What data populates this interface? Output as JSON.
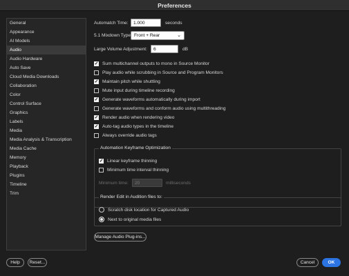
{
  "window": {
    "title": "Preferences"
  },
  "sidebar": {
    "items": [
      {
        "label": "General"
      },
      {
        "label": "Appearance"
      },
      {
        "label": "AI Models"
      },
      {
        "label": "Audio"
      },
      {
        "label": "Audio Hardware"
      },
      {
        "label": "Auto Save"
      },
      {
        "label": "Cloud Media Downloads"
      },
      {
        "label": "Collaboration"
      },
      {
        "label": "Color"
      },
      {
        "label": "Control Surface"
      },
      {
        "label": "Graphics"
      },
      {
        "label": "Labels"
      },
      {
        "label": "Media"
      },
      {
        "label": "Media Analysis & Transcription"
      },
      {
        "label": "Media Cache"
      },
      {
        "label": "Memory"
      },
      {
        "label": "Playback"
      },
      {
        "label": "Plugins"
      },
      {
        "label": "Timeline"
      },
      {
        "label": "Trim"
      }
    ],
    "selected": "Audio"
  },
  "audio": {
    "automatch": {
      "label": "Automatch Time:",
      "value": "1.000",
      "unit": "seconds"
    },
    "mixdown": {
      "label": "5.1 Mixdown Type:",
      "value": "Front + Rear"
    },
    "large_volume": {
      "label": "Large Volume Adjustment:",
      "value": "6",
      "unit": "dB"
    },
    "checkboxes": [
      {
        "label": "Sum multichannel outputs to mono in Source Monitor",
        "checked": true
      },
      {
        "label": "Play audio while scrubbing in Source and Program Monitors",
        "checked": false
      },
      {
        "label": "Maintain pitch while shuttling",
        "checked": true
      },
      {
        "label": "Mute input during timeline recording",
        "checked": false
      },
      {
        "label": "Generate waveforms automatically during import",
        "checked": true
      },
      {
        "label": "Generate waveforms and conform audio using multithreading",
        "checked": false
      },
      {
        "label": "Render audio when rendering video",
        "checked": true
      },
      {
        "label": "Auto-tag audio types in the timeline",
        "checked": true
      },
      {
        "label": "Always override audio tags",
        "checked": false
      }
    ],
    "keyframe_group": {
      "title": "Automation Keyframe Optimization",
      "linear": {
        "label": "Linear keyframe thinning",
        "checked": true
      },
      "min_interval": {
        "label": "Minimum time interval thinning",
        "checked": false
      },
      "min_time": {
        "label": "Minimum time:",
        "value": "20",
        "unit": "milliseconds"
      }
    },
    "audition_group": {
      "title": "Render Edit in Audition files to:",
      "options": [
        {
          "label": "Scratch disk location for Captured Audio",
          "selected": false
        },
        {
          "label": "Next to original media files",
          "selected": true
        }
      ]
    },
    "manage_plugins_label": "Manage Audio Plug-ins..."
  },
  "footer": {
    "help": "Help",
    "reset": "Reset...",
    "cancel": "Cancel",
    "ok": "OK"
  },
  "colors": {
    "accent": "#2b74e2",
    "background": "#1e1e1e"
  }
}
